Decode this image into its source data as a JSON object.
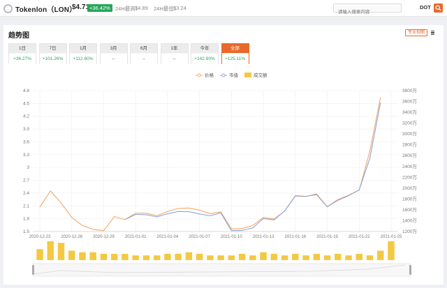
{
  "header": {
    "coin_name": "Tokenlon（LON）",
    "price": "$4.71",
    "change": "+36.42%",
    "high_label": "24H最高：",
    "high_value": "$4.89",
    "low_label": "24H最低：",
    "low_value": "$3.24",
    "search_placeholder": "请输入搜索内容",
    "exchange": "DOT"
  },
  "card": {
    "title": "趋势图",
    "pro_label": "专业视图"
  },
  "tabs": [
    {
      "label": "1日",
      "value": "+36.27%"
    },
    {
      "label": "7日",
      "value": "+101.26%"
    },
    {
      "label": "1月",
      "value": "+112.60%"
    },
    {
      "label": "3月",
      "value": "--"
    },
    {
      "label": "6月",
      "value": "--"
    },
    {
      "label": "1年",
      "value": "--"
    },
    {
      "label": "今年",
      "value": "+142.80%"
    },
    {
      "label": "全部",
      "value": "+125.11%"
    }
  ],
  "active_tab": 7,
  "colors": {
    "price": "#f5a867",
    "market_cap": "#8fa3d9",
    "volume": "#f5c842",
    "positive": "#26a65b",
    "accent": "#e8692a"
  },
  "chart_data": {
    "type": "line",
    "legend": [
      "价格",
      "市值",
      "成交额"
    ],
    "legend_position": "top-center",
    "x": [
      "2020-12-23",
      "2020-12-24",
      "2020-12-25",
      "2020-12-26",
      "2020-12-27",
      "2020-12-28",
      "2020-12-29",
      "2020-12-30",
      "2020-12-31",
      "2021-01-01",
      "2021-01-02",
      "2021-01-03",
      "2021-01-04",
      "2021-01-05",
      "2021-01-06",
      "2021-01-07",
      "2021-01-08",
      "2021-01-09",
      "2021-01-10",
      "2021-01-11",
      "2021-01-12",
      "2021-01-13",
      "2021-01-14",
      "2021-01-15",
      "2021-01-16",
      "2021-01-17",
      "2021-01-18",
      "2021-01-19",
      "2021-01-20",
      "2021-01-21",
      "2021-01-22",
      "2021-01-23",
      "2021-01-24",
      "2021-01-25"
    ],
    "x_tick_labels": [
      "2020-12-23",
      "2020-12-26",
      "2020-12-29",
      "2021-01-01",
      "2021-01-04",
      "2021-01-07",
      "2021-01-10",
      "2021-01-13",
      "2021-01-16",
      "2021-01-19",
      "2021-01-22",
      "2021-01-25"
    ],
    "y_left_ticks": [
      "4.8",
      "4.5",
      "4.2",
      "3.9",
      "3.6",
      "3.3",
      "3",
      "2.7",
      "2.4",
      "2.1",
      "1.8",
      "1.5"
    ],
    "y_left_range": [
      1.5,
      4.8
    ],
    "y_right_ticks": [
      "3800万",
      "3600万",
      "3400万",
      "3200万",
      "3000万",
      "2800万",
      "2600万",
      "2400万",
      "2200万",
      "2000万",
      "1800万",
      "1600万",
      "1400万",
      "1200万"
    ],
    "y_right_range": [
      1200,
      3800
    ],
    "series": [
      {
        "name": "价格",
        "axis": "left",
        "start_index": 0,
        "values": [
          2.07,
          2.45,
          2.17,
          1.83,
          1.64,
          1.55,
          1.52,
          1.85,
          1.78,
          1.93,
          1.93,
          1.87,
          1.97,
          2.04,
          2.05,
          2.0,
          1.92,
          1.96,
          1.56,
          1.57,
          1.64,
          1.83,
          1.79,
          1.98,
          2.33,
          2.32,
          2.38,
          2.08,
          2.25,
          2.35,
          2.47,
          3.38,
          4.64
        ]
      },
      {
        "name": "市值",
        "axis": "right",
        "start_index": 8,
        "values": [
          1420,
          1515,
          1510,
          1470,
          1530,
          1570,
          1565,
          1525,
          1490,
          1545,
          1215,
          1220,
          1265,
          1440,
          1415,
          1580,
          1860,
          1850,
          1880,
          1655,
          1775,
          1860,
          1970,
          2550,
          3580
        ]
      }
    ],
    "volume": {
      "name": "成交额",
      "values": [
        7,
        12,
        11,
        6,
        5,
        5,
        4,
        4,
        4,
        3,
        3,
        3,
        4,
        4,
        5,
        4,
        3,
        3,
        3,
        4,
        3,
        5,
        4,
        3,
        4,
        3,
        4,
        3,
        4,
        3,
        4,
        3,
        6,
        12
      ]
    }
  }
}
